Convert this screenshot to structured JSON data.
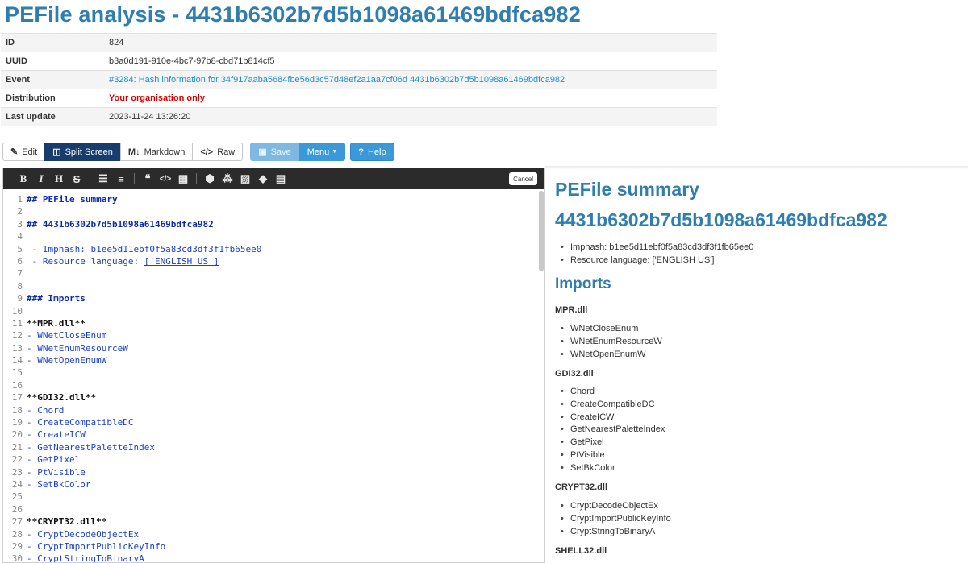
{
  "page_title": "PEFile analysis - 4431b6302b7d5b1098a61469bdfca982",
  "meta": {
    "id_label": "ID",
    "id_value": "824",
    "uuid_label": "UUID",
    "uuid_value": "b3a0d191-910e-4bc7-97b8-cbd71b814cf5",
    "event_label": "Event",
    "event_value": "#3284: Hash information for 34f917aaba5684fbe56d3c57d48ef2a1aa7cf06d 4431b6302b7d5b1098a61469bdfca982",
    "distribution_label": "Distribution",
    "distribution_value": "Your organisation only",
    "last_update_label": "Last update",
    "last_update_value": "2023-11-24 13:26:20"
  },
  "toolbar": {
    "edit": "Edit",
    "split": "Split Screen",
    "markdown": "Markdown",
    "raw": "Raw",
    "save": "Save",
    "menu": "Menu",
    "help": "Help"
  },
  "editor": {
    "cancel": "Cancel",
    "tools": [
      "B",
      "I",
      "H",
      "S",
      "ul",
      "ol",
      "quote",
      "code",
      "table",
      "cube",
      "cubes",
      "image",
      "tag",
      "book"
    ],
    "lines": [
      "## PEFile summary",
      "",
      "## 4431b6302b7d5b1098a61469bdfca982",
      "",
      " - Imphash: b1ee5d11ebf0f5a83cd3df3f1fb65ee0",
      " - Resource language: ['ENGLISH US']",
      "",
      "",
      "### Imports",
      "",
      "**MPR.dll**",
      "- WNetCloseEnum",
      "- WNetEnumResourceW",
      "- WNetOpenEnumW",
      "",
      "",
      "**GDI32.dll**",
      "- Chord",
      "- CreateCompatibleDC",
      "- CreateICW",
      "- GetNearestPaletteIndex",
      "- GetPixel",
      "- PtVisible",
      "- SetBkColor",
      "",
      "",
      "**CRYPT32.dll**",
      "- CryptDecodeObjectEx",
      "- CryptImportPublicKeyInfo",
      "- CryptStringToBinaryA"
    ]
  },
  "preview": {
    "h1": "PEFile summary",
    "h2": "4431b6302b7d5b1098a61469bdfca982",
    "summary": [
      "Imphash: b1ee5d11ebf0f5a83cd3df3f1fb65ee0",
      "Resource language: ['ENGLISH US']"
    ],
    "imports_heading": "Imports",
    "mpr": "MPR.dll",
    "mpr_items": [
      "WNetCloseEnum",
      "WNetEnumResourceW",
      "WNetOpenEnumW"
    ],
    "gdi": "GDI32.dll",
    "gdi_items": [
      "Chord",
      "CreateCompatibleDC",
      "CreateICW",
      "GetNearestPaletteIndex",
      "GetPixel",
      "PtVisible",
      "SetBkColor"
    ],
    "crypt": "CRYPT32.dll",
    "crypt_items": [
      "CryptDecodeObjectEx",
      "CryptImportPublicKeyInfo",
      "CryptStringToBinaryA"
    ],
    "shell": "SHELL32.dll"
  },
  "colors": {
    "title": "#2f7eb0",
    "link": "#1f8fd0",
    "danger": "#dd0000",
    "primary": "#3a9ad9",
    "active": "#173d6d"
  }
}
